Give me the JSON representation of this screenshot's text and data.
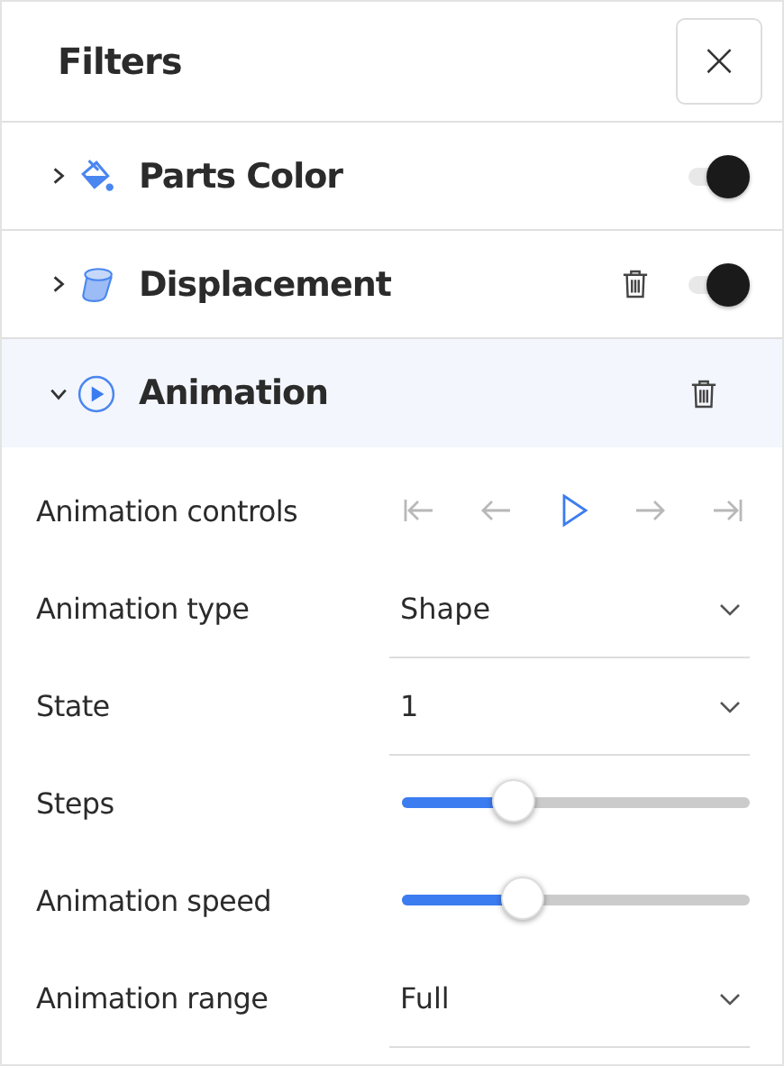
{
  "title": "Filters",
  "close": {
    "label": "×"
  },
  "filters": [
    {
      "label": "Parts Color",
      "expanded": false,
      "deletable": false,
      "on": true
    },
    {
      "label": "Displacement",
      "expanded": false,
      "deletable": true,
      "on": true
    },
    {
      "label": "Animation",
      "expanded": true,
      "deletable": true
    }
  ],
  "settings": [
    {
      "kind": "buttons",
      "label": "Animation controls",
      "buttons": [
        {
          "active": false
        },
        {
          "active": false
        },
        {
          "active": true
        },
        {
          "active": false
        },
        {
          "active": false
        }
      ]
    },
    {
      "kind": "dropdown",
      "label": "Animation type",
      "value": "Shape"
    },
    {
      "kind": "dropdown",
      "label": "State",
      "value": "1"
    },
    {
      "kind": "slider",
      "label": "Steps",
      "level": 0.32
    },
    {
      "kind": "slider",
      "label": "Animation speed",
      "level": 0.345
    },
    {
      "kind": "dropdown",
      "label": "Animation range",
      "value": "Full"
    }
  ]
}
